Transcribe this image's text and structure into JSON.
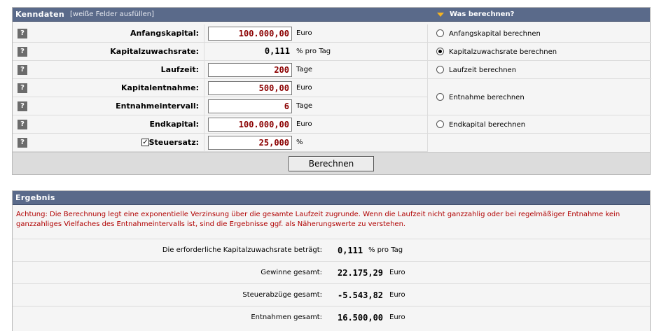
{
  "kenndaten": {
    "title": "Kenndaten",
    "hint": "[weiße Felder ausfüllen]",
    "calc_title": "Was berechnen?",
    "help_glyph": "?",
    "rows": [
      {
        "label": "Anfangskapital:",
        "value": "100.000,00",
        "unit": "Euro"
      },
      {
        "label": "Kapitalzuwachsrate:",
        "value": "0,111",
        "unit": "% pro Tag"
      },
      {
        "label": "Laufzeit:",
        "value": "200",
        "unit": "Tage"
      },
      {
        "label": "Kapitalentnahme:",
        "value": "500,00",
        "unit": "Euro"
      },
      {
        "label": "Entnahmeintervall:",
        "value": "6",
        "unit": "Tage"
      },
      {
        "label": "Endkapital:",
        "value": "100.000,00",
        "unit": "Euro"
      },
      {
        "label": "Steuersatz:",
        "value": "25,000",
        "unit": "%",
        "checkbox_mark": "✓"
      }
    ],
    "options": [
      {
        "label": "Anfangskapital berechnen",
        "selected": false
      },
      {
        "label": "Kapitalzuwachsrate berechnen",
        "selected": true
      },
      {
        "label": "Laufzeit berechnen",
        "selected": false
      },
      {
        "label": "Entnahme berechnen",
        "selected": false
      },
      {
        "label": "Endkapital berechnen",
        "selected": false
      }
    ],
    "button_label": "Berechnen"
  },
  "ergebnis": {
    "title": "Ergebnis",
    "warning": "Achtung: Die Berechnung legt eine exponentielle Verzinsung über die gesamte Laufzeit zugrunde. Wenn die Laufzeit nicht ganzzahlig oder bei regelmäßiger Entnahme kein ganzzahliges Vielfaches des Entnahmeintervalls ist, sind die Ergebnisse ggf. als Näherungswerte zu verstehen.",
    "rows": [
      {
        "label": "Die erforderliche Kapitalzuwachsrate beträgt:",
        "value": "0,111",
        "unit": "% pro Tag"
      },
      {
        "label": "Gewinne gesamt:",
        "value": "22.175,29",
        "unit": "Euro"
      },
      {
        "label": "Steuerabzüge gesamt:",
        "value": "-5.543,82",
        "unit": "Euro"
      },
      {
        "label": "Entnahmen gesamt:",
        "value": "16.500,00",
        "unit": "Euro"
      }
    ]
  },
  "colors": {
    "header_bg": "#5a6a8a",
    "accent_triangle": "#f4b321",
    "input_text": "#8b0000",
    "warning_text": "#b00000"
  }
}
